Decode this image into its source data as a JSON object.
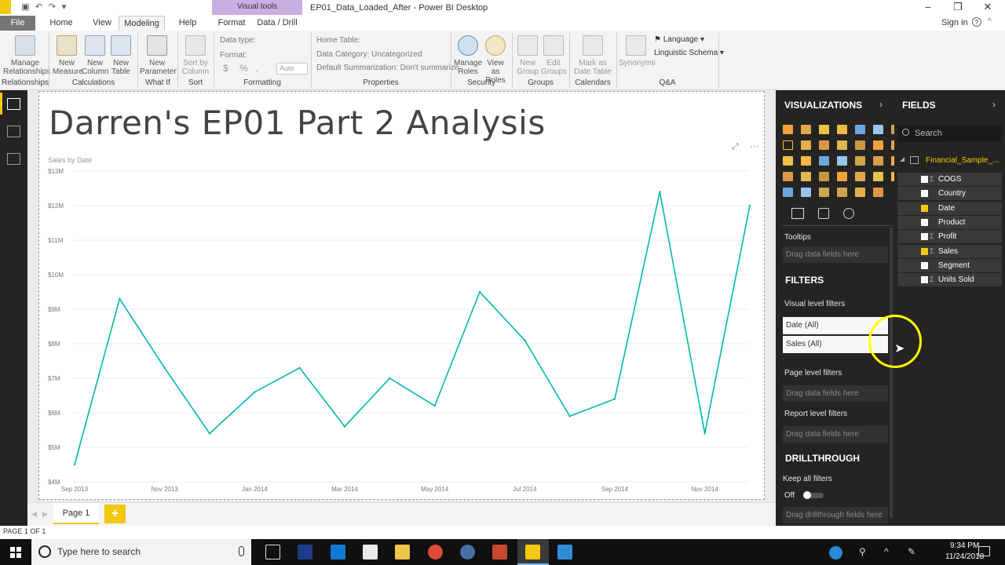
{
  "window": {
    "title": "EP01_Data_Loaded_After - Power BI Desktop",
    "context_band": "Visual tools",
    "signin": "Sign in"
  },
  "tabs": [
    "File",
    "Home",
    "View",
    "Modeling",
    "Help",
    "Format",
    "Data / Drill"
  ],
  "ribbon": {
    "groups": [
      "Relationships",
      "Calculations",
      "What If",
      "Sort",
      "Formatting",
      "Properties",
      "Security",
      "Groups",
      "Calendars",
      "Q&A"
    ],
    "buttons": {
      "manage_relationships": "Manage Relationships",
      "new_measure": "New Measure",
      "new_column": "New Column",
      "new_table": "New Table",
      "new_parameter": "New Parameter",
      "sort_by_column": "Sort by Column",
      "manage_roles": "Manage Roles",
      "view_as_roles": "View as Roles",
      "new_group": "New Group",
      "edit_groups": "Edit Groups",
      "mark_as_date_table": "Mark as Date Table",
      "synonyms": "Synonyms",
      "language": "Language",
      "linguistic_schema": "Linguistic Schema"
    },
    "formatting": {
      "data_type": "Data type:",
      "format": "Format:",
      "currency": "$",
      "percent": "%",
      "comma": ",",
      "auto": "Auto"
    },
    "properties": {
      "home_table": "Home Table:",
      "data_category": "Data Category: Uncategorized",
      "default_summarization": "Default Summarization: Don't summarize"
    }
  },
  "report": {
    "title": "Darren's EP01 Part 2 Analysis"
  },
  "chart_data": {
    "type": "line",
    "title": "Sales by Date",
    "x": [
      "Sep 2013",
      "Oct 2013",
      "Nov 2013",
      "Dec 2013",
      "Jan 2014",
      "Feb 2014",
      "Mar 2014",
      "Apr 2014",
      "May 2014",
      "Jun 2014",
      "Jul 2014",
      "Aug 2014",
      "Sep 2014",
      "Oct 2014",
      "Nov 2014",
      "Dec 2014"
    ],
    "x_tick_labels": [
      "Sep 2013",
      "Nov 2013",
      "Jan 2014",
      "Mar 2014",
      "May 2014",
      "Jul 2014",
      "Sep 2014",
      "Nov 2014"
    ],
    "y_tick_labels": [
      "$4M",
      "$5M",
      "$6M",
      "$7M",
      "$8M",
      "$9M",
      "$10M",
      "$11M",
      "$12M",
      "$13M"
    ],
    "ylim": [
      4,
      13
    ],
    "values": [
      4.5,
      9.3,
      7.3,
      5.4,
      6.6,
      7.3,
      5.6,
      7.0,
      6.2,
      9.5,
      8.1,
      5.9,
      6.4,
      12.4,
      5.4,
      12.0
    ],
    "color": "#01b8aa",
    "grid": true
  },
  "pages": {
    "tab": "Page 1",
    "add": "+",
    "count": "PAGE 1 OF 1"
  },
  "visualizations": {
    "header": "VISUALIZATIONS",
    "tooltips_label": "Tooltips",
    "drag_fields": "Drag data fields here"
  },
  "filters": {
    "header": "FILTERS",
    "visual_level": "Visual level filters",
    "items": [
      "Date (All)",
      "Sales (All)"
    ],
    "page_level": "Page level filters",
    "report_level": "Report level filters",
    "drag_fields": "Drag data fields here"
  },
  "drillthrough": {
    "header": "DRILLTHROUGH",
    "keep_all": "Keep all filters",
    "toggle": "Off",
    "drag": "Drag drillthrough fields here"
  },
  "fields": {
    "header": "FIELDS",
    "search_placeholder": "Search",
    "table": "Financial_Sample_...",
    "items": [
      {
        "name": "COGS",
        "sigma": true,
        "checked": false
      },
      {
        "name": "Country",
        "sigma": false,
        "checked": false
      },
      {
        "name": "Date",
        "sigma": false,
        "checked": true
      },
      {
        "name": "Product",
        "sigma": false,
        "checked": false
      },
      {
        "name": "Profit",
        "sigma": true,
        "checked": false
      },
      {
        "name": "Sales",
        "sigma": true,
        "checked": true
      },
      {
        "name": "Segment",
        "sigma": false,
        "checked": false
      },
      {
        "name": "Units Sold",
        "sigma": true,
        "checked": false
      }
    ]
  },
  "taskbar": {
    "search_placeholder": "Type here to search",
    "time": "9:34 PM",
    "date": "11/24/2018"
  },
  "colors": {
    "accent": "#f2c811",
    "pane_bg": "#252423",
    "line": "#01b8aa"
  }
}
